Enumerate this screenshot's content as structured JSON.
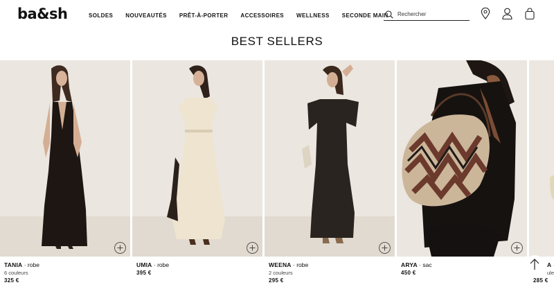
{
  "header": {
    "logo": "ba&sh",
    "nav": [
      "SOLDES",
      "NOUVEAUTÉS",
      "PRÊT-À-PORTER",
      "ACCESSOIRES",
      "WELLNESS",
      "SECONDE MAIN"
    ],
    "search_placeholder": "Rechercher",
    "icons": [
      "search-icon",
      "store-locator-icon",
      "account-icon",
      "bag-icon"
    ]
  },
  "page_title": "BEST SELLERS",
  "products": [
    {
      "name": "TANIA",
      "category": "robe",
      "colors": "6 couleurs",
      "price": "325 €"
    },
    {
      "name": "UMIA",
      "category": "robe",
      "colors": "",
      "price": "395 €"
    },
    {
      "name": "WEENA",
      "category": "robe",
      "colors": "2 couleurs",
      "price": "295 €"
    },
    {
      "name": "ARYA",
      "category": "sac",
      "colors": "",
      "price": "450 €"
    },
    {
      "name": "A",
      "category": "",
      "colors": "uleurs",
      "price": "285 €"
    }
  ],
  "separator": " · ",
  "colors": {
    "text": "#111111",
    "background": "#ffffff"
  }
}
